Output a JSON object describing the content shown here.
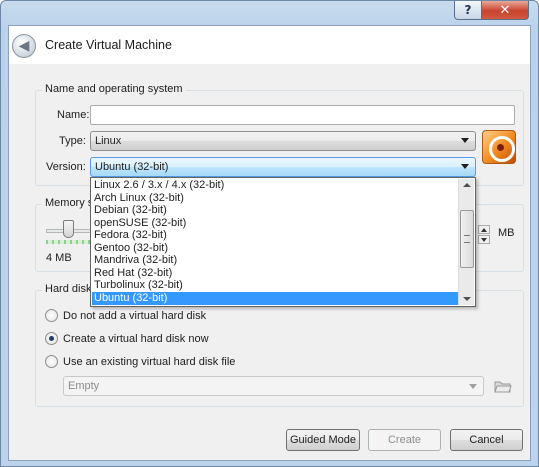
{
  "window": {
    "help_glyph": "?",
    "close_glyph": "✕"
  },
  "wizard": {
    "title": "Create Virtual Machine",
    "back_glyph": "◀"
  },
  "name_os": {
    "group_title": "Name and operating system",
    "name_label": "Name:",
    "name_value": "",
    "type_label": "Type:",
    "type_value": "Linux",
    "version_label": "Version:",
    "version_value": "Ubuntu (32-bit)"
  },
  "version_options": [
    "Linux 2.6 / 3.x / 4.x (32-bit)",
    "Arch Linux (32-bit)",
    "Debian (32-bit)",
    "openSUSE (32-bit)",
    "Fedora (32-bit)",
    "Gentoo (32-bit)",
    "Mandriva (32-bit)",
    "Red Hat (32-bit)",
    "Turbolinux (32-bit)",
    "Ubuntu (32-bit)"
  ],
  "version_selected_index": 9,
  "memory": {
    "group_title_visible": "Memory s",
    "min_label": "4 MB",
    "unit": "MB"
  },
  "hard_disk": {
    "group_title": "Hard disk",
    "options": [
      "Do not add a virtual hard disk",
      "Create a virtual hard disk now",
      "Use an existing virtual hard disk file"
    ],
    "checked_index": 1,
    "existing_file_value": "Empty"
  },
  "buttons": {
    "guided_mode": "Guided Mode",
    "create": "Create",
    "cancel": "Cancel"
  }
}
